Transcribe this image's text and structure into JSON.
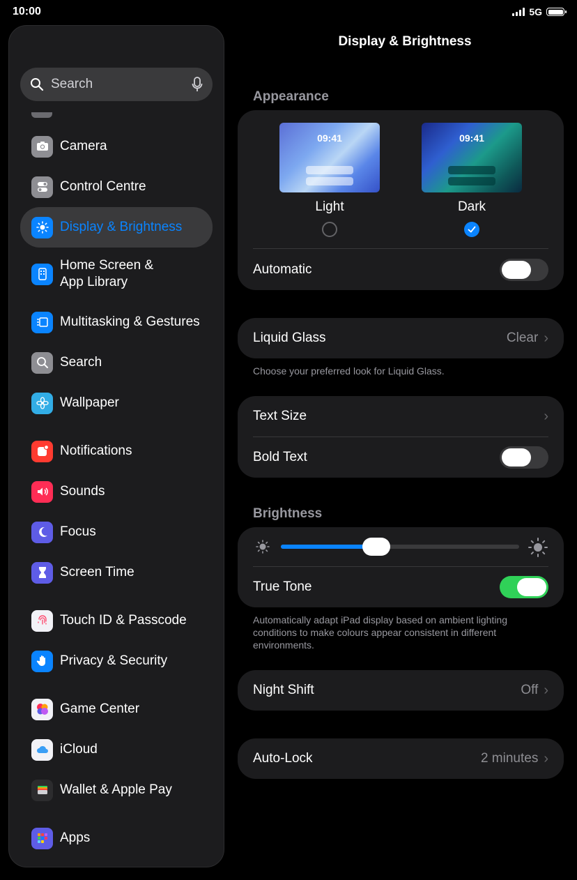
{
  "status": {
    "time": "10:00",
    "network": "5G"
  },
  "sidebar": {
    "search_placeholder": "Search",
    "items": [
      {
        "label": "Camera",
        "icon": "camera-icon",
        "color": "#8e8e93"
      },
      {
        "label": "Control Centre",
        "icon": "switches-icon",
        "color": "#8e8e93"
      },
      {
        "label": "Display & Brightness",
        "icon": "sun-icon",
        "color": "#0a84ff",
        "active": true
      },
      {
        "label": "Home Screen &",
        "label2": "App Library",
        "icon": "home-grid-icon",
        "color": "#0a84ff"
      },
      {
        "label": "Multitasking & Gestures",
        "icon": "multitasking-icon",
        "color": "#0a84ff"
      },
      {
        "label": "Search",
        "icon": "magnifier-icon",
        "color": "#8e8e93"
      },
      {
        "label": "Wallpaper",
        "icon": "flower-icon",
        "color": "#32ade6"
      },
      {
        "label": "Notifications",
        "icon": "bell-icon",
        "color": "#ff3b30"
      },
      {
        "label": "Sounds",
        "icon": "speaker-icon",
        "color": "#ff2d55"
      },
      {
        "label": "Focus",
        "icon": "moon-icon",
        "color": "#5e5ce6"
      },
      {
        "label": "Screen Time",
        "icon": "hourglass-icon",
        "color": "#5e5ce6"
      },
      {
        "label": "Touch ID & Passcode",
        "icon": "fingerprint-icon",
        "color": "#ffffff"
      },
      {
        "label": "Privacy & Security",
        "icon": "hand-icon",
        "color": "#0a84ff"
      },
      {
        "label": "Game Center",
        "icon": "game-center-icon",
        "color": "#ffffff"
      },
      {
        "label": "iCloud",
        "icon": "cloud-icon",
        "color": "#ffffff"
      },
      {
        "label": "Wallet & Apple Pay",
        "icon": "wallet-icon",
        "color": "#2c2c2e"
      },
      {
        "label": "Apps",
        "icon": "apps-grid-icon",
        "color": "#5e5ce6"
      }
    ]
  },
  "main": {
    "title": "Display & Brightness",
    "appearance": {
      "header": "Appearance",
      "light": {
        "label": "Light",
        "time": "09:41",
        "selected": false
      },
      "dark": {
        "label": "Dark",
        "time": "09:41",
        "selected": true
      },
      "automatic_label": "Automatic",
      "automatic_on": false
    },
    "liquid_glass": {
      "label": "Liquid Glass",
      "value": "Clear",
      "footnote": "Choose your preferred look for Liquid Glass."
    },
    "text": {
      "text_size_label": "Text Size",
      "bold_text_label": "Bold Text",
      "bold_text_on": false
    },
    "brightness": {
      "header": "Brightness",
      "level": 0.4,
      "true_tone_label": "True Tone",
      "true_tone_on": true,
      "footnote": "Automatically adapt iPad display based on ambient lighting conditions to make colours appear consistent in different environments."
    },
    "night_shift": {
      "label": "Night Shift",
      "value": "Off"
    },
    "auto_lock": {
      "label": "Auto-Lock",
      "value": "2 minutes"
    }
  },
  "colors": {
    "accent": "#0a84ff",
    "toggle_on": "#30d158"
  }
}
